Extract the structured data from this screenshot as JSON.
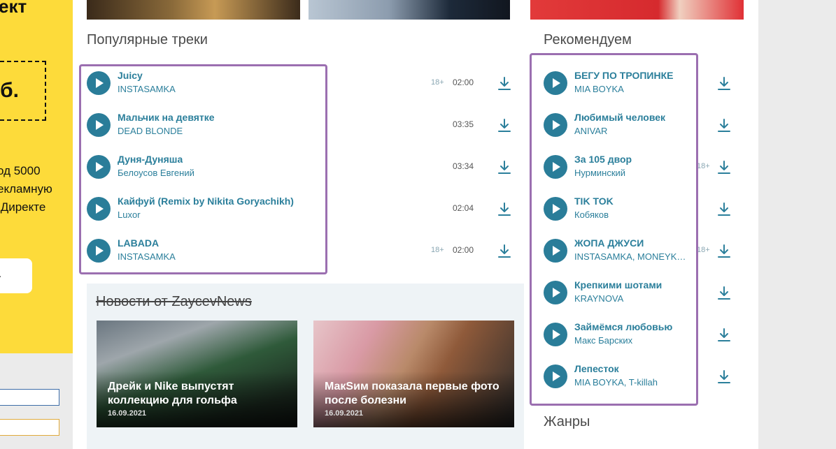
{
  "ad": {
    "title": "ект",
    "price": "б.",
    "lines": [
      "од 5000",
      "екламную",
      ".Директе"
    ],
    "button": "."
  },
  "popular": {
    "title": "Популярные треки",
    "tracks": [
      {
        "title": "Juicy",
        "artist": "INSTASAMKA",
        "age": "18+",
        "duration": "02:00"
      },
      {
        "title": "Мальчик на девятке",
        "artist": "DEAD BLONDE",
        "age": "",
        "duration": "03:35"
      },
      {
        "title": "Дуня-Дуняша",
        "artist": "Белоусов Евгений",
        "age": "",
        "duration": "03:34"
      },
      {
        "title": "Кайфуй (Remix by Nikita Goryachikh)",
        "artist": "Luxor",
        "age": "",
        "duration": "02:04"
      },
      {
        "title": "LABADA",
        "artist": "INSTASAMKA",
        "age": "18+",
        "duration": "02:00"
      }
    ]
  },
  "recommend": {
    "title": "Рекомендуем",
    "tracks": [
      {
        "title": "БЕГУ ПО ТРОПИНКЕ",
        "artist": "MIA BOYKA",
        "age": ""
      },
      {
        "title": "Любимый человек",
        "artist": "ANIVAR",
        "age": ""
      },
      {
        "title": "За 105 двор",
        "artist": "Нурминский",
        "age": "18+"
      },
      {
        "title": "TIK TOK",
        "artist": "Кобяков",
        "age": ""
      },
      {
        "title": "ЖОПА ДЖУСИ",
        "artist": "INSTASAMKA, MONEYKEN",
        "age": "18+"
      },
      {
        "title": "Крепкими шотами",
        "artist": "KRAYNOVA",
        "age": ""
      },
      {
        "title": "Займёмся любовью",
        "artist": "Макс Барских",
        "age": ""
      },
      {
        "title": "Лепесток",
        "artist": "MIA BOYKA, T-killah",
        "age": ""
      }
    ]
  },
  "news": {
    "title": "Новости от ZaycevNews",
    "cards": [
      {
        "headline": "Дрейк и Nike выпустят коллекцию для гольфа",
        "date": "16.09.2021"
      },
      {
        "headline": "МакSим показала первые фото после болезни",
        "date": "16.09.2021"
      }
    ]
  },
  "genres": {
    "title": "Жанры"
  },
  "colors": {
    "accent": "#2b7f9b",
    "highlight": "#9b6fb0",
    "ad_bg": "#fddb3a"
  },
  "icons": {
    "play": "play-icon",
    "download": "download-icon"
  }
}
